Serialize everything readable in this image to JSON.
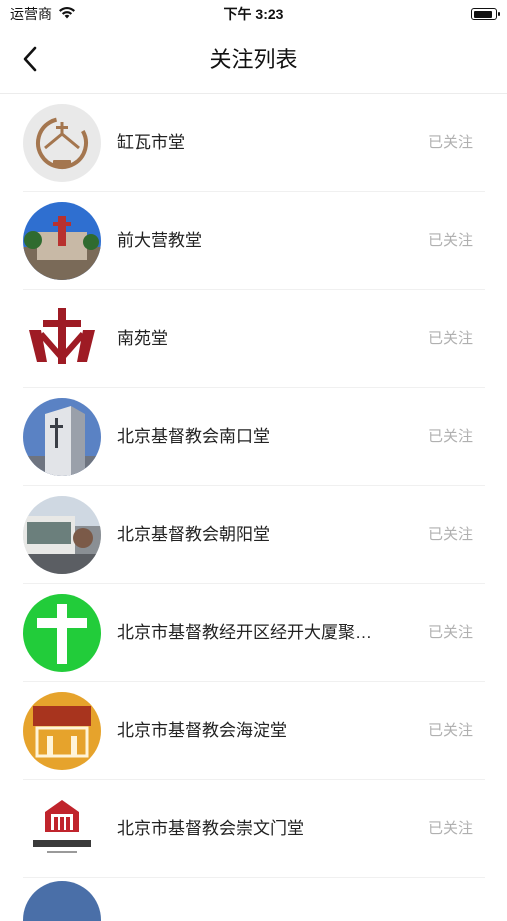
{
  "status_bar": {
    "carrier": "运营商",
    "time": "下午 3:23"
  },
  "header": {
    "title": "关注列表"
  },
  "follow_list": [
    {
      "name": "缸瓦市堂",
      "status": "已关注",
      "avatar": "church-logo-1863"
    },
    {
      "name": "前大营教堂",
      "status": "已关注",
      "avatar": "church-photo-blue-sky"
    },
    {
      "name": "南苑堂",
      "status": "已关注",
      "avatar": "red-cross-logo"
    },
    {
      "name": "北京基督教会南口堂",
      "status": "已关注",
      "avatar": "church-tower-photo"
    },
    {
      "name": "北京基督教会朝阳堂",
      "status": "已关注",
      "avatar": "church-building-photo"
    },
    {
      "name": "北京市基督教经开区经开大厦聚…",
      "status": "已关注",
      "avatar": "white-cross-green"
    },
    {
      "name": "北京市基督教会海淀堂",
      "status": "已关注",
      "avatar": "haidian-church-logo"
    },
    {
      "name": "北京市基督教会崇文门堂",
      "status": "已关注",
      "avatar": "chwmch-logo"
    }
  ],
  "colors": {
    "follow_text": "#b0b0b0",
    "divider": "#f0f0f0"
  }
}
